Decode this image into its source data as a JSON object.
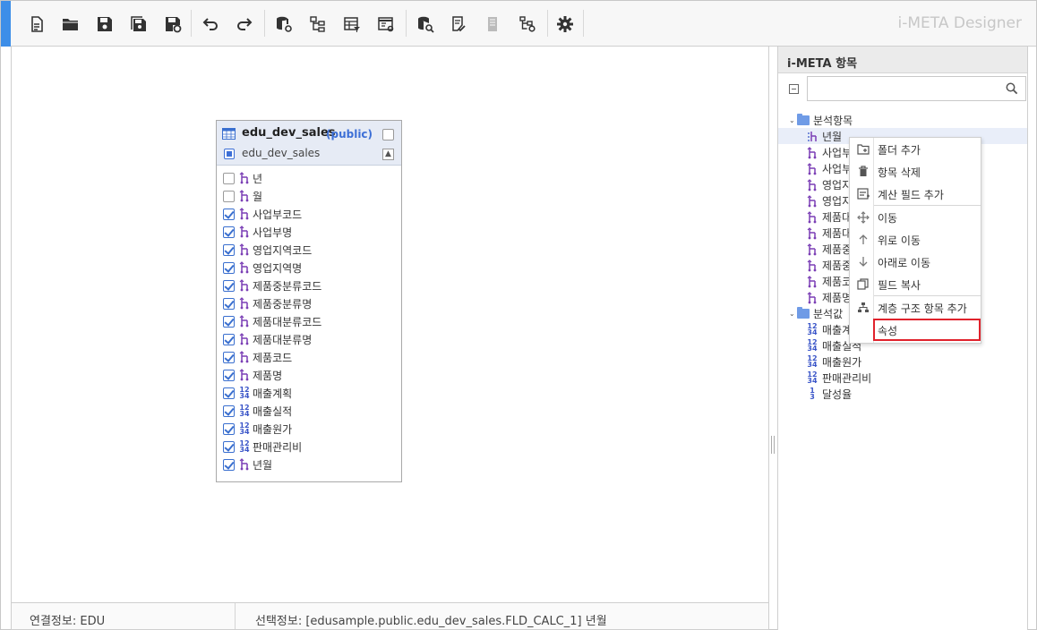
{
  "app": {
    "title": "i-META Designer",
    "accent_color": "#3d8ee8"
  },
  "toolbar": {
    "buttons": [
      {
        "icon": "new-document-icon"
      },
      {
        "icon": "open-folder-icon"
      },
      {
        "icon": "save-icon"
      },
      {
        "icon": "save-all-icon"
      },
      {
        "icon": "save-settings-icon"
      },
      {
        "icon": "undo-icon"
      },
      {
        "icon": "redo-icon"
      },
      {
        "icon": "database-link-icon"
      },
      {
        "icon": "hierarchy-icon"
      },
      {
        "icon": "table-filter-icon"
      },
      {
        "icon": "window-settings-icon"
      },
      {
        "icon": "database-search-icon"
      },
      {
        "icon": "checklist-icon"
      },
      {
        "icon": "document-disabled-icon"
      },
      {
        "icon": "hierarchy-settings-icon"
      },
      {
        "icon": "gear-icon"
      }
    ]
  },
  "table": {
    "name": "edu_dev_sales",
    "schema": "(public)",
    "subname": "edu_dev_sales",
    "fields": [
      {
        "label": "년",
        "checked": false,
        "type": "dimension"
      },
      {
        "label": "월",
        "checked": false,
        "type": "dimension"
      },
      {
        "label": "사업부코드",
        "checked": true,
        "type": "dimension"
      },
      {
        "label": "사업부명",
        "checked": true,
        "type": "dimension"
      },
      {
        "label": "영업지역코드",
        "checked": true,
        "type": "dimension"
      },
      {
        "label": "영업지역명",
        "checked": true,
        "type": "dimension"
      },
      {
        "label": "제품중분류코드",
        "checked": true,
        "type": "dimension"
      },
      {
        "label": "제품중분류명",
        "checked": true,
        "type": "dimension"
      },
      {
        "label": "제품대분류코드",
        "checked": true,
        "type": "dimension"
      },
      {
        "label": "제품대분류명",
        "checked": true,
        "type": "dimension"
      },
      {
        "label": "제품코드",
        "checked": true,
        "type": "dimension"
      },
      {
        "label": "제품명",
        "checked": true,
        "type": "dimension"
      },
      {
        "label": "매출계획",
        "checked": true,
        "type": "measure"
      },
      {
        "label": "매출실적",
        "checked": true,
        "type": "measure"
      },
      {
        "label": "매출원가",
        "checked": true,
        "type": "measure"
      },
      {
        "label": "판매관리비",
        "checked": true,
        "type": "measure"
      },
      {
        "label": "년월",
        "checked": true,
        "type": "dimension"
      }
    ]
  },
  "status": {
    "connection": "연결정보: EDU",
    "selection": "선택정보: [edusample.public.edu_dev_sales.FLD_CALC_1] 년월"
  },
  "panel": {
    "title": "i-META 항목",
    "search_placeholder": "",
    "tree": [
      {
        "kind": "folder",
        "label": "분석항목"
      },
      {
        "kind": "calc",
        "label": "년월",
        "highlight": true
      },
      {
        "kind": "dim",
        "label": "사업부"
      },
      {
        "kind": "dim",
        "label": "사업부"
      },
      {
        "kind": "dim",
        "label": "영업지"
      },
      {
        "kind": "dim",
        "label": "영업지"
      },
      {
        "kind": "dim",
        "label": "제품대"
      },
      {
        "kind": "dim",
        "label": "제품대"
      },
      {
        "kind": "dim",
        "label": "제품중"
      },
      {
        "kind": "dim",
        "label": "제품중"
      },
      {
        "kind": "dim",
        "label": "제품코"
      },
      {
        "kind": "dim",
        "label": "제품명"
      },
      {
        "kind": "folder",
        "label": "분석값"
      },
      {
        "kind": "num",
        "label": "매출계"
      },
      {
        "kind": "num",
        "label": "매출실적"
      },
      {
        "kind": "num",
        "label": "매출원가"
      },
      {
        "kind": "num",
        "label": "판매관리비"
      },
      {
        "kind": "calcnum",
        "label": "달성율"
      }
    ]
  },
  "context_menu": {
    "items": [
      {
        "label": "폴더 추가",
        "icon": "add-folder-icon"
      },
      {
        "label": "항목 삭제",
        "icon": "trash-icon"
      },
      {
        "label": "계산 필드 추가",
        "icon": "calc-field-icon"
      },
      {
        "label": "이동",
        "icon": "move-icon"
      },
      {
        "label": "위로 이동",
        "icon": "arrow-up-icon"
      },
      {
        "label": "아래로 이동",
        "icon": "arrow-down-icon"
      },
      {
        "label": "필드 복사",
        "icon": "copy-icon"
      },
      {
        "label": "계층 구조 항목 추가",
        "icon": "hierarchy-icon"
      },
      {
        "label": "속성",
        "icon": ""
      }
    ],
    "selected_color": "#e0222c"
  }
}
